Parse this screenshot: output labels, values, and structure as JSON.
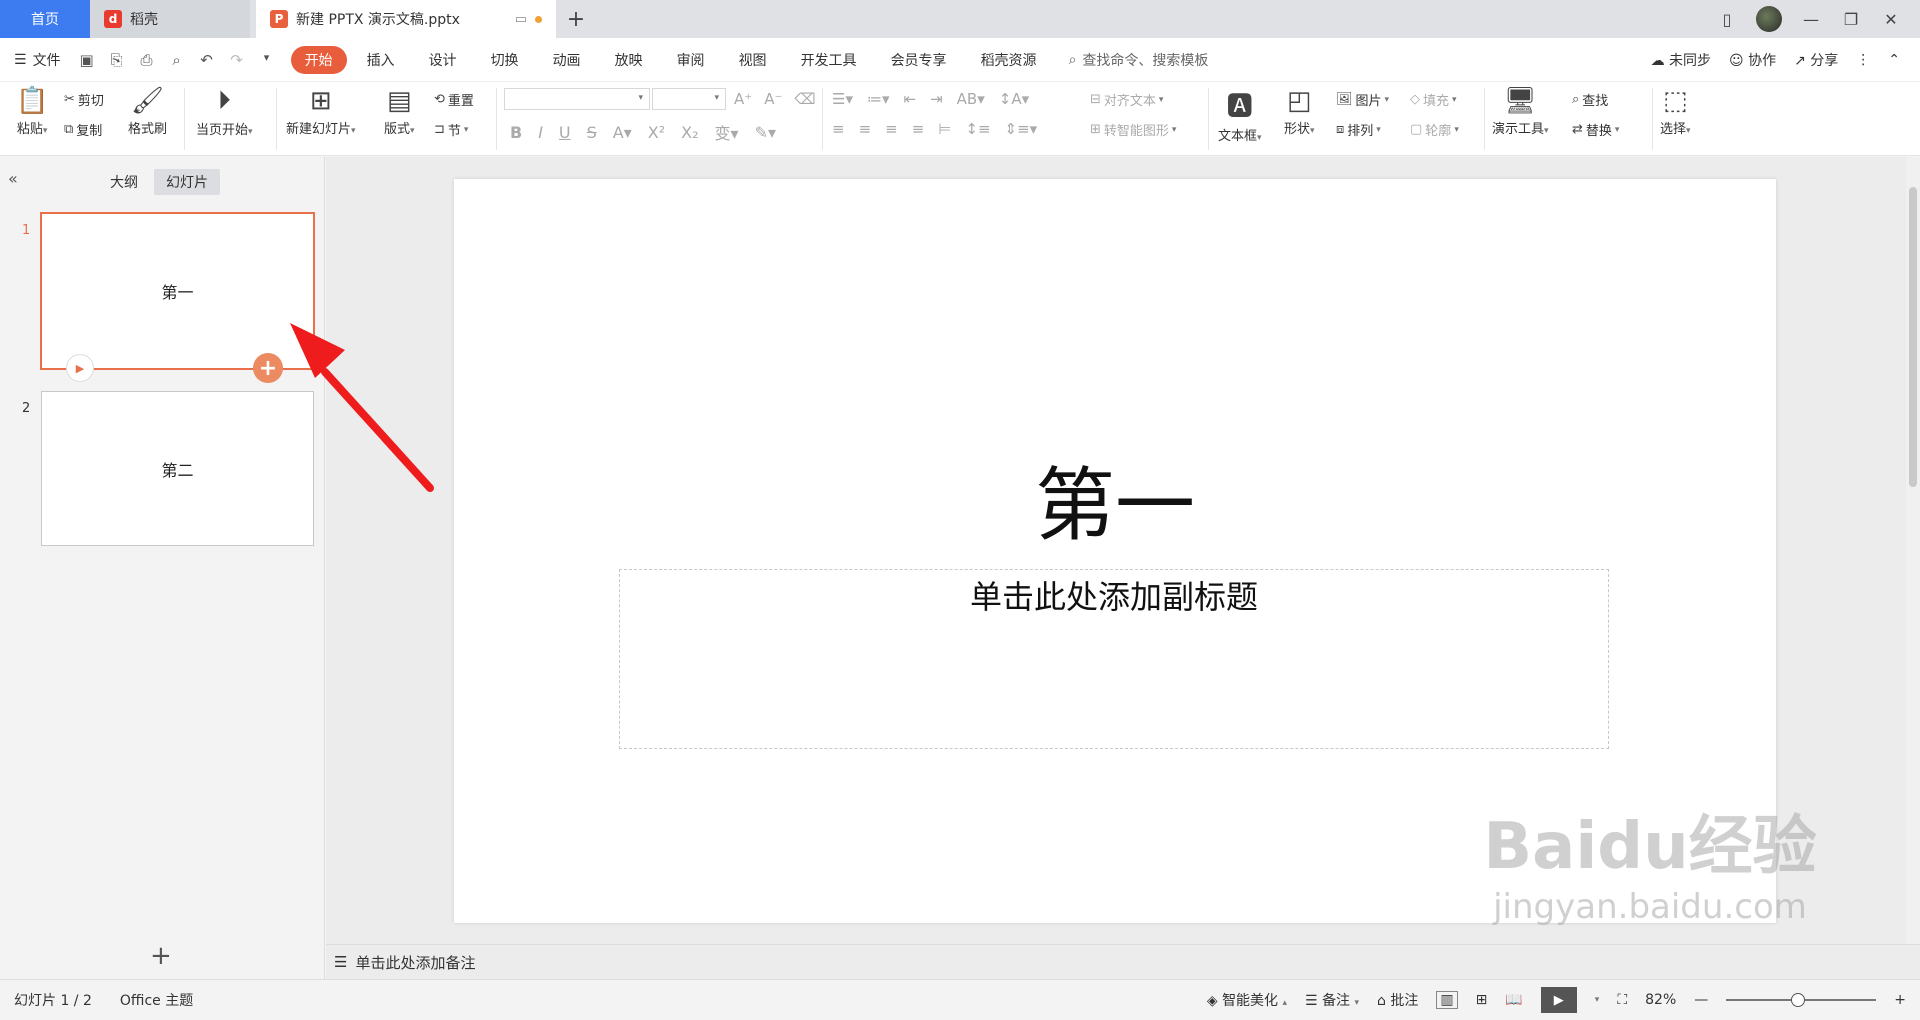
{
  "tabs": {
    "home": "首页",
    "daoke": "稻壳",
    "doc": "新建 PPTX 演示文稿.pptx",
    "add": "+"
  },
  "menu": {
    "file": "文件",
    "items": [
      "开始",
      "插入",
      "设计",
      "切换",
      "动画",
      "放映",
      "审阅",
      "视图",
      "开发工具",
      "会员专享",
      "稻壳资源"
    ],
    "active_index": 0,
    "search_placeholder": "查找命令、搜索模板",
    "sync": "未同步",
    "collab": "协作",
    "share": "分享"
  },
  "ribbon": {
    "paste": "粘贴",
    "cut": "剪切",
    "copy": "复制",
    "format_painter": "格式刷",
    "from_current": "当页开始",
    "new_slide": "新建幻灯片",
    "layout": "版式",
    "reset": "重置",
    "section": "节",
    "align_text": "对齐文本",
    "smart_art": "转智能图形",
    "textbox": "文本框",
    "shape": "形状",
    "picture": "图片",
    "arrange": "排列",
    "fill": "填充",
    "outline": "轮廓",
    "present_tools": "演示工具",
    "find": "查找",
    "replace": "替换",
    "select": "选择"
  },
  "left_panel": {
    "outline_tab": "大纲",
    "slides_tab": "幻灯片",
    "slides": [
      {
        "num": "1",
        "title": "第一"
      },
      {
        "num": "2",
        "title": "第二"
      }
    ],
    "add_label": "+"
  },
  "slide": {
    "title": "第一",
    "subtitle": "单击此处添加副标题"
  },
  "notes": {
    "placeholder": "单击此处添加备注"
  },
  "status": {
    "slide_count": "幻灯片 1 / 2",
    "theme": "Office 主题",
    "beautify": "智能美化",
    "notes": "备注",
    "comments": "批注",
    "zoom": "82%",
    "zoom_fraction": 0.48
  },
  "watermark": {
    "line1": "Baidu经验",
    "line2": "jingyan.baidu.com"
  },
  "colors": {
    "accent": "#e85d3c",
    "home_tab": "#3d7bf0",
    "annotation": "#ee1c1c"
  }
}
